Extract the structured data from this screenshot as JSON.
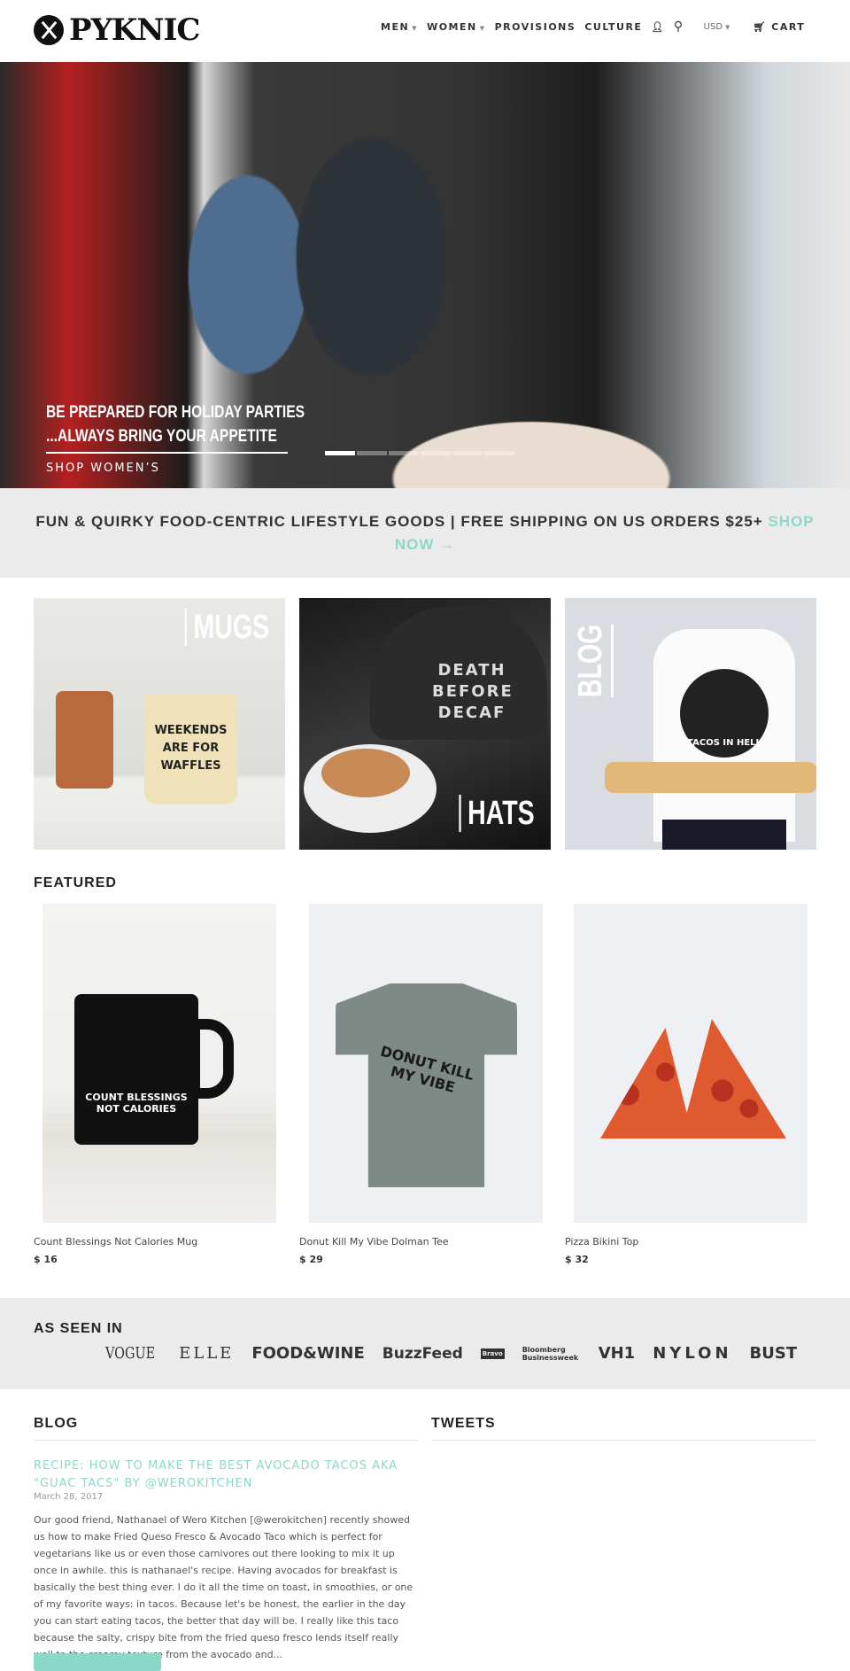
{
  "header": {
    "logo": "PYKNIC",
    "nav": [
      {
        "label": "MEN",
        "dropdown": true
      },
      {
        "label": "WOMEN",
        "dropdown": true
      },
      {
        "label": "PROVISIONS"
      },
      {
        "label": "CULTURE"
      }
    ],
    "currency": "USD",
    "cart": "CART",
    "icons": [
      "user-icon",
      "search-icon",
      "cart-icon"
    ]
  },
  "hero": {
    "line1": "BE PREPARED FOR HOLIDAY PARTIES",
    "line2": "...ALWAYS BRING YOUR APPETITE",
    "link": "SHOP WOMEN’S",
    "slides": 6,
    "active_slide": 1
  },
  "banner": {
    "text": "FUN & QUIRKY FOOD-CENTRIC LIFESTYLE GOODS  |  FREE SHIPPING ON US ORDERS $25+",
    "link": "SHOP NOW →"
  },
  "collections": [
    {
      "label": "MUGS",
      "image_text": "WEEKENDS ARE FOR WAFFLES"
    },
    {
      "label": "HATS",
      "image_text": "DEATH BEFORE DECAF"
    },
    {
      "label": "BLOG",
      "image_text": "TACOS IN HELL"
    }
  ],
  "featured": {
    "title": "FEATURED",
    "products": [
      {
        "name": "Count Blessings Not Calories Mug",
        "price": "$ 16",
        "image_text": "COUNT BLESSINGS NOT CALORIES"
      },
      {
        "name": "Donut Kill My Vibe Dolman Tee",
        "price": "$ 29",
        "image_text": "DONUT KILL MY VIBE"
      },
      {
        "name": "Pizza Bikini Top",
        "price": "$ 32"
      }
    ]
  },
  "as_seen_in": {
    "title": "AS SEEN IN",
    "logos": [
      "VOGUE",
      "ELLE",
      "FOOD&WINE",
      "BuzzFeed",
      "Bravo",
      "Bloomberg Businessweek",
      "VH1",
      "NYLON",
      "BUST"
    ]
  },
  "blog": {
    "title": "BLOG",
    "post_title": "RECIPE: HOW TO MAKE THE BEST AVOCADO TACOS AKA \"GUAC TACS\" BY @WEROKITCHEN",
    "date": "March 28, 2017",
    "excerpt": "Our good friend, Nathanael of Wero Kitchen [@werokitchen] recently showed us how to make Fried Queso Fresco & Avocado Taco which is perfect for vegetarians like us or even those carnivores out there looking to mix it up once in awhile. this is nathanael's recipe. Having avocados for breakfast is basically the best thing ever. I do it all the time on toast, in smoothies, or one of my favorite ways: in tacos. Because let's be honest, the earlier in the day you can start eating tacos, the better that day will be. I really like this taco because the salty, crispy bite from the fried queso fresco lends itself really well to the creamy texture from the avocado and..."
  },
  "tweets": {
    "title": "TWEETS"
  },
  "colors": {
    "accent": "#8cd8c8",
    "banner_bg": "#ebebeb",
    "text": "#333333"
  }
}
